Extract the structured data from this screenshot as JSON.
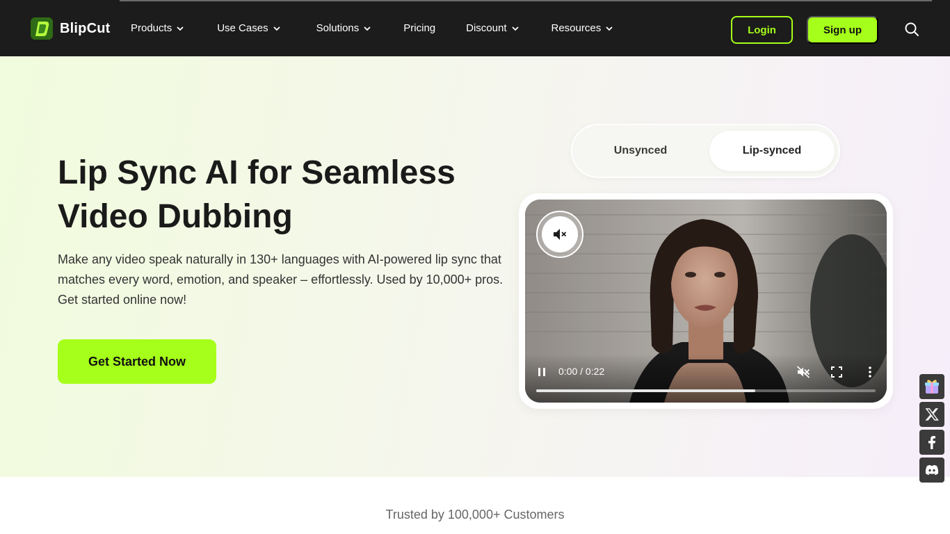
{
  "brand": {
    "name": "BlipCut"
  },
  "nav": {
    "items": [
      {
        "label": "Products",
        "has_dropdown": true
      },
      {
        "label": "Use Cases",
        "has_dropdown": true
      },
      {
        "label": "Solutions",
        "has_dropdown": true
      },
      {
        "label": "Pricing",
        "has_dropdown": false
      },
      {
        "label": "Discount",
        "has_dropdown": true
      },
      {
        "label": "Resources",
        "has_dropdown": true
      }
    ],
    "login_label": "Login",
    "signup_label": "Sign up",
    "search_icon": "search-icon"
  },
  "hero": {
    "title": "Lip Sync AI for Seamless Video Dubbing",
    "subtitle": "Make any video speak naturally in 130+ languages with AI-powered lip sync that matches every word, emotion, and speaker – effortlessly. Used by 10,000+ pros. Get started online now!",
    "cta_label": "Get Started Now"
  },
  "toggle": {
    "options": [
      "Unsynced",
      "Lip-synced"
    ],
    "selected": "Lip-synced"
  },
  "video": {
    "time_display": "0:00 / 0:22",
    "progress_fraction": 0.645,
    "muted": true
  },
  "social": [
    "gift-icon",
    "x-icon",
    "facebook-icon",
    "discord-icon"
  ],
  "trusted": {
    "text": "Trusted by 100,000+ Customers"
  },
  "colors": {
    "accent": "#a6ff1a",
    "header_bg": "#1c1c1c",
    "social_bg": "#3b3b3b"
  }
}
